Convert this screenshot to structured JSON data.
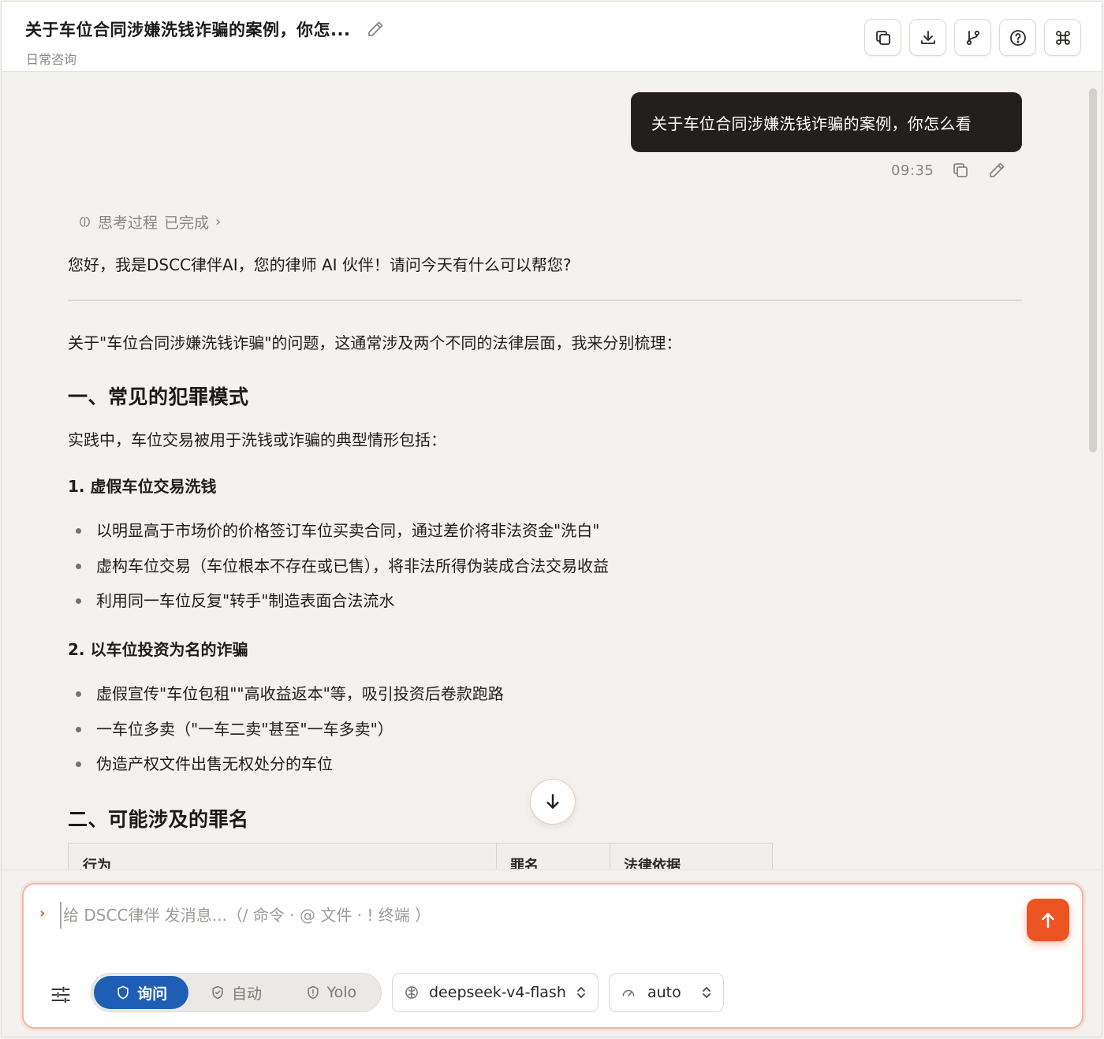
{
  "header": {
    "title": "关于车位合同涉嫌洗钱诈骗的案例，你怎...",
    "subtitle": "日常咨询",
    "tools": [
      "copy-icon",
      "download-icon",
      "branch-icon",
      "help-icon",
      "command-icon"
    ]
  },
  "user_message": {
    "text": "关于车位合同涉嫌洗钱诈骗的案例，你怎么看",
    "time": "09:35"
  },
  "thinking": {
    "label": "思考过程",
    "status": "已完成"
  },
  "answer": {
    "greeting": "您好，我是DSCC律伴AI，您的律师 AI 伙伴！请问今天有什么可以帮您?",
    "intro": "关于\"车位合同涉嫌洗钱诈骗\"的问题，这通常涉及两个不同的法律层面，我来分别梳理：",
    "section1": {
      "heading": "一、常见的犯罪模式",
      "lead": "实践中，车位交易被用于洗钱或诈骗的典型情形包括：",
      "sub1": {
        "heading": "1. 虚假车位交易洗钱",
        "items": [
          "以明显高于市场价的价格签订车位买卖合同，通过差价将非法资金\"洗白\"",
          "虚构车位交易（车位根本不存在或已售），将非法所得伪装成合法交易收益",
          "利用同一车位反复\"转手\"制造表面合法流水"
        ]
      },
      "sub2": {
        "heading": "2. 以车位投资为名的诈骗",
        "items": [
          "虚假宣传\"车位包租\"\"高收益返本\"等，吸引投资后卷款跑路",
          "一车位多卖（\"一车二卖\"甚至\"一车多卖\"）",
          "伪造产权文件出售无权处分的车位"
        ]
      }
    },
    "section2": {
      "heading": "二、可能涉及的罪名",
      "table_headers": [
        "行为",
        "罪名",
        "法律依据"
      ]
    }
  },
  "composer": {
    "placeholder": "给 DSCC律伴 发消息...（/ 命令 · @ 文件 · ! 终端 ）",
    "value": "",
    "modes": [
      "询问",
      "自动",
      "Yolo"
    ],
    "active_mode": "询问",
    "model": "deepseek-v4-flash",
    "effort": "auto"
  },
  "colors": {
    "accent": "#ec5424",
    "mode_active": "#1e5fb5",
    "user_bubble": "#221f1e",
    "background": "#f3f2ef"
  }
}
